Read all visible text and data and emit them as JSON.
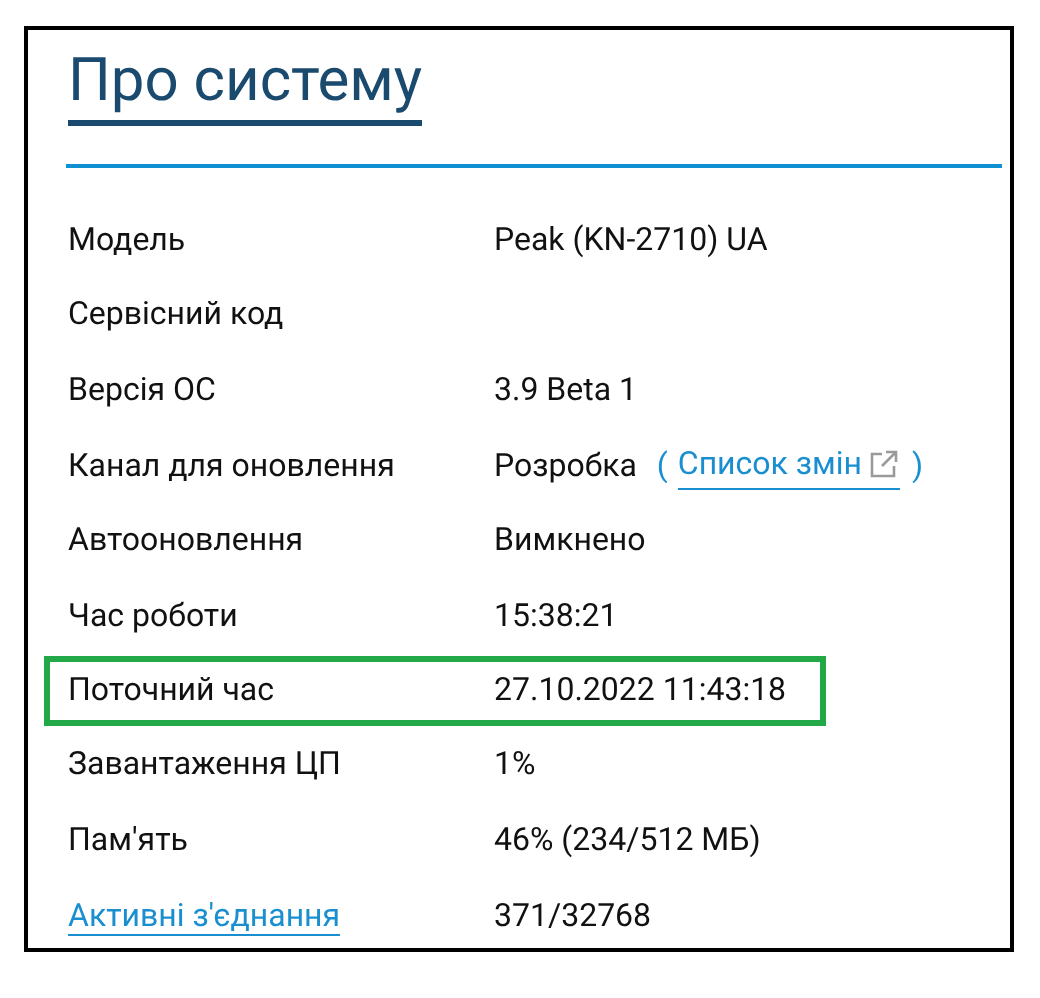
{
  "title": "Про систему",
  "rows": [
    {
      "label": "Модель",
      "value": "Peak (KN-2710) UA",
      "label_is_link": false,
      "highlighted": false
    },
    {
      "label": "Сервісний код",
      "label_is_link": false,
      "highlighted": false
    },
    {
      "label": "Версія ОС",
      "value": "3.9 Beta 1",
      "label_is_link": false,
      "highlighted": false
    },
    {
      "label": "Канал для оновлення",
      "value": "Розробка",
      "link": {
        "open": "(",
        "text": "Список змін",
        "close": ")"
      },
      "label_is_link": false,
      "highlighted": false
    },
    {
      "label": "Автооновлення",
      "value": "Вимкнено",
      "label_is_link": false,
      "highlighted": false
    },
    {
      "label": "Час роботи",
      "value": "15:38:21",
      "label_is_link": false,
      "highlighted": false
    },
    {
      "label": "Поточний час",
      "value": "27.10.2022 11:43:18",
      "label_is_link": false,
      "highlighted": true
    },
    {
      "label": "Завантаження ЦП",
      "value": "1%",
      "label_is_link": false,
      "highlighted": false
    },
    {
      "label": "Пам'ять",
      "value": "46% (234/512 МБ)",
      "label_is_link": false,
      "highlighted": false
    },
    {
      "label": "Активні з'єднання",
      "value": "371/32768",
      "label_is_link": true,
      "highlighted": false
    }
  ]
}
